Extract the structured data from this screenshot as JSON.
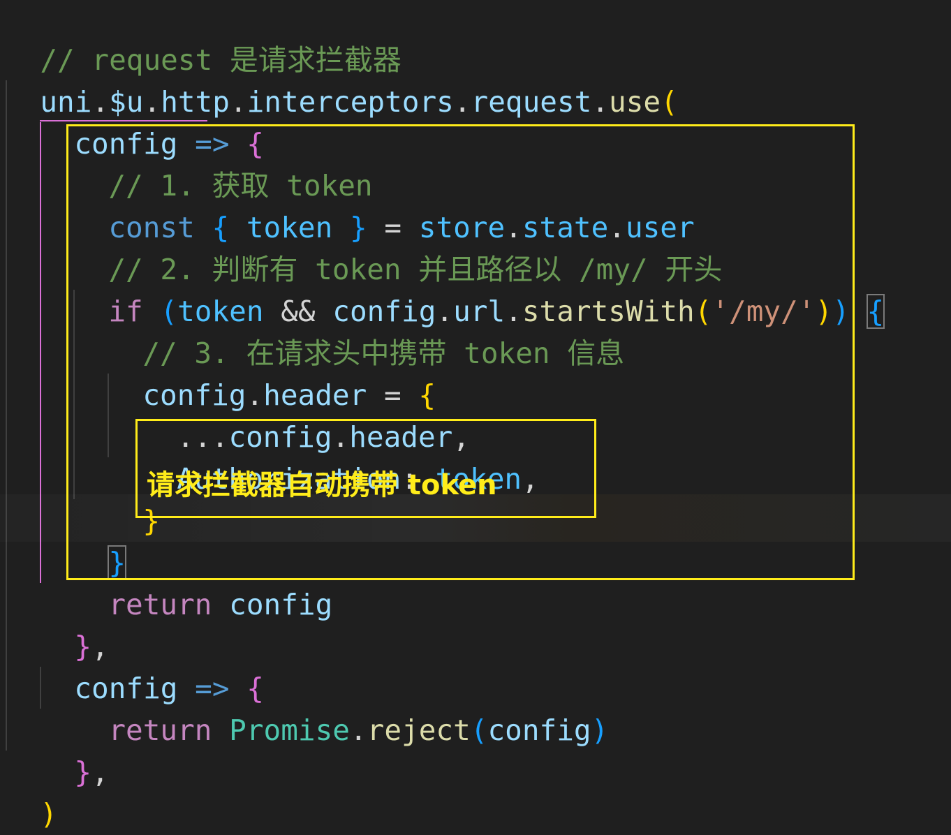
{
  "code": {
    "line1_comment": "// request 是请求拦截器",
    "line2": {
      "obj": "uni",
      "dot1": ".",
      "u": "$u",
      "dot2": ".",
      "http": "http",
      "dot3": ".",
      "interceptors": "interceptors",
      "dot4": ".",
      "request": "request",
      "dot5": ".",
      "use": "use",
      "paren": "("
    },
    "line3": {
      "param": "config",
      "arrow": " => ",
      "brace": "{"
    },
    "line4_comment": "// 1. 获取 token",
    "line5": {
      "kw": "const",
      "open": " { ",
      "var": "token",
      "close": " }",
      "eq": " = ",
      "obj": "store",
      "d1": ".",
      "state": "state",
      "d2": ".",
      "user": "user"
    },
    "line6_comment": "// 2. 判断有 token 并且路径以 /my/ 开头",
    "line7": {
      "kw": "if",
      "sp": " ",
      "open": "(",
      "token": "token",
      "and": " && ",
      "config": "config",
      "d1": ".",
      "url": "url",
      "d2": ".",
      "fn": "startsWith",
      "po": "(",
      "str": "'/my/'",
      "pc": ")",
      "close": ")",
      "sp2": " ",
      "brace": "{"
    },
    "line8_comment": "// 3. 在请求头中携带 token 信息",
    "line9": {
      "config": "config",
      "d": ".",
      "header": "header",
      "eq": " = ",
      "brace": "{"
    },
    "line10": {
      "spread": "...",
      "config": "config",
      "d": ".",
      "header": "header",
      "comma": ","
    },
    "line11": {
      "key": "Authorization",
      "colon": ": ",
      "val": "token",
      "comma": ","
    },
    "line12_brace": "}",
    "line13_brace": "}",
    "line14": {
      "kw": "return",
      "sp": " ",
      "val": "config"
    },
    "line15": {
      "brace": "}",
      "comma": ","
    },
    "line16": {
      "param": "config",
      "arrow": " => ",
      "brace": "{"
    },
    "line17": {
      "kw": "return",
      "sp": " ",
      "cls": "Promise",
      "d": ".",
      "fn": "reject",
      "po": "(",
      "arg": "config",
      "pc": ")"
    },
    "line18": {
      "brace": "}",
      "comma": ","
    },
    "line19_paren": ")"
  },
  "annotation": {
    "callout_text": "请求拦截器自动携带 token",
    "highlight_color": "#ffec1a"
  }
}
